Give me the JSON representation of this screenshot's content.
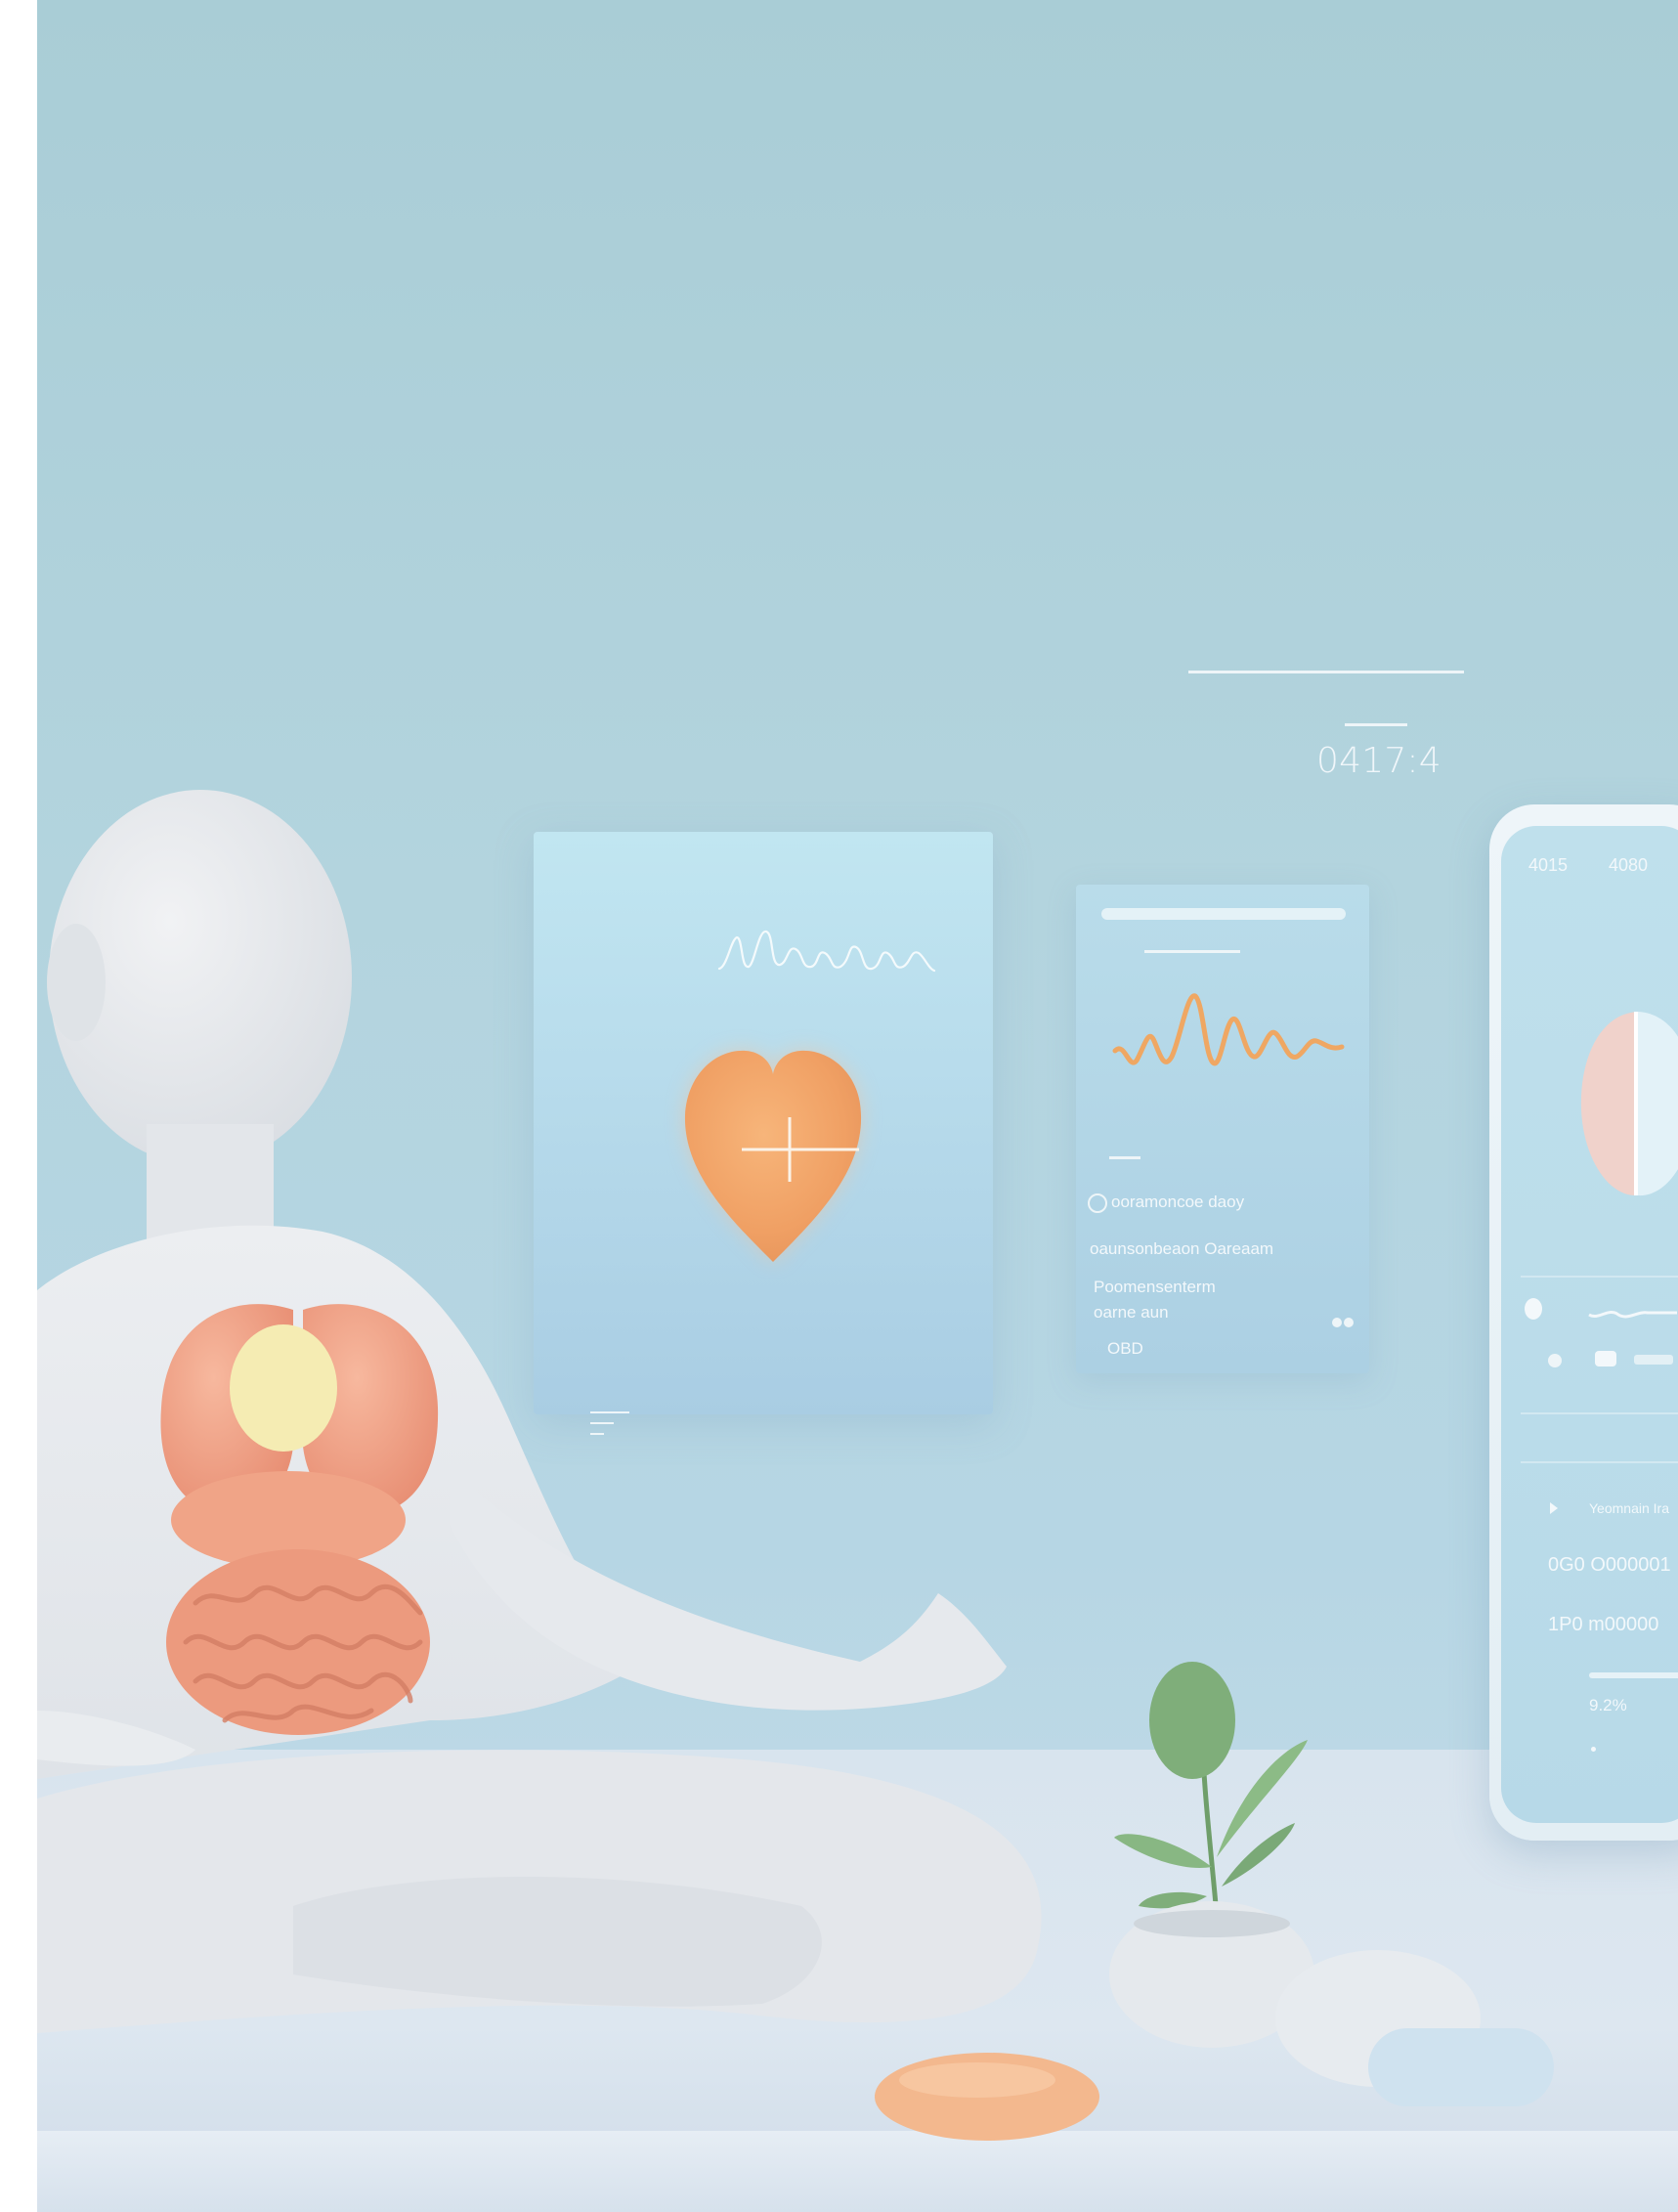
{
  "display": {
    "time_readout": "0417:4"
  },
  "metrics_panel": {
    "rows": [
      "ooramoncoe daoy",
      "oaunsonbeaon Oareaam",
      "Poomensenterm",
      "oarne aun",
      "OBD"
    ]
  },
  "phone": {
    "status_left": "4015",
    "status_right": "4080",
    "list_items": [
      "Yeomnain Ira",
      "0G0 O000001",
      "1P0 m00000",
      "9.2%"
    ]
  },
  "colors": {
    "background": "#b3d4de",
    "heart": "#f2a86a",
    "organs": "#ef9f86",
    "figure": "#e9ecef",
    "plant": "#7fae7a",
    "pebble_orange": "#f3b88e",
    "pebble_blue": "#cfe2ef"
  }
}
